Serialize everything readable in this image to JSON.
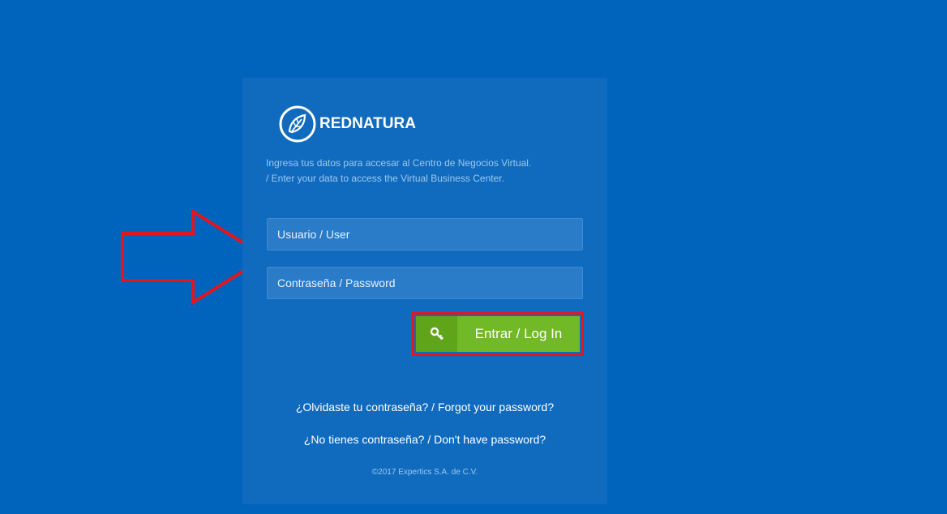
{
  "brand": {
    "name": "REDNATURA",
    "logo_icon": "leaf-circle-logo"
  },
  "intro": {
    "line_es": "Ingresa tus datos para accesar al Centro de Negocios Virtual.",
    "line_en": "/ Enter your data to access the Virtual Business Center."
  },
  "form": {
    "user_placeholder": "Usuario / User",
    "user_value": "",
    "password_placeholder": "Contraseña / Password",
    "password_value": "",
    "login_label": "Entrar / Log In",
    "login_icon": "key-icon"
  },
  "links": {
    "forgot": "¿Olvidaste tu contraseña? / Forgot your password?",
    "no_password": "¿No tienes contraseña? / Don't have password?"
  },
  "footer": {
    "copyright": "©2017 Expertics S.A. de C.V."
  },
  "colors": {
    "background": "#0064bd",
    "panel": "#106bbf",
    "button": "#72b928",
    "annotation": "#e3161d"
  },
  "annotations": {
    "arrow_icon": "red-outline-arrow-right-icon",
    "highlight": "red-box-around-login-button"
  }
}
